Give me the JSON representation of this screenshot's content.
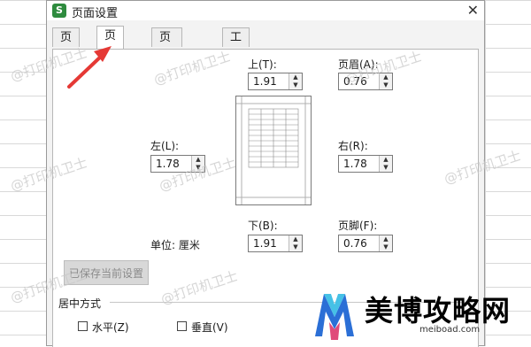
{
  "app": {
    "icon_letter": "S",
    "title": "页面设置"
  },
  "tabs": [
    {
      "label": "页面",
      "active": false
    },
    {
      "label": "页边距",
      "active": true
    },
    {
      "label": "页眉/页脚",
      "active": false
    },
    {
      "label": "工作表",
      "active": false
    }
  ],
  "margins": {
    "top": {
      "label": "上(T):",
      "value": "1.91"
    },
    "header": {
      "label": "页眉(A):",
      "value": "0.76"
    },
    "left": {
      "label": "左(L):",
      "value": "1.78"
    },
    "right": {
      "label": "右(R):",
      "value": "1.78"
    },
    "bottom": {
      "label": "下(B):",
      "value": "1.91"
    },
    "footer": {
      "label": "页脚(F):",
      "value": "0.76"
    }
  },
  "unit": {
    "label": "单位: 厘米"
  },
  "save_button": {
    "label": "已保存当前设置"
  },
  "center": {
    "title": "居中方式",
    "horizontal": "水平(Z)",
    "vertical": "垂直(V)"
  },
  "watermark_text": "@打印机卫士",
  "brand": {
    "name": "美博攻略网",
    "url": "meiboad.com"
  },
  "colors": {
    "accent": "#2e8b3e",
    "arrow": "#e53935"
  }
}
